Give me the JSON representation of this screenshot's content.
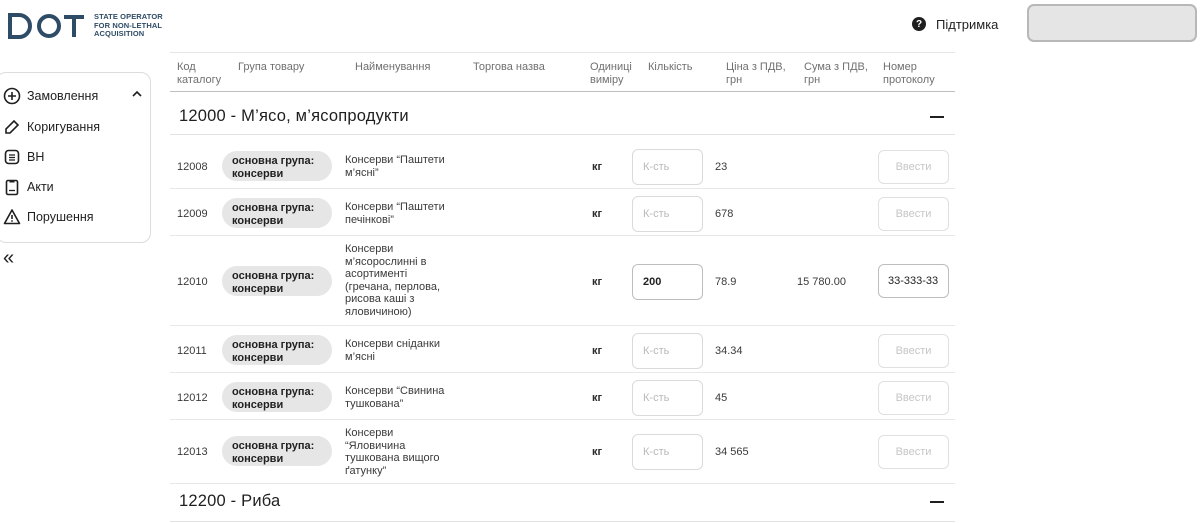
{
  "header": {
    "logo_text": "DOT",
    "logo_subtitle_1": "STATE OPERATOR",
    "logo_subtitle_2": "FOR NON-LETHAL",
    "logo_subtitle_3": "ACQUISITION",
    "support_label": "Підтримка",
    "support_icon": "question-circle-icon"
  },
  "sidebar": {
    "items": [
      {
        "label": "Замовлення",
        "icon": "plus-circle-icon"
      },
      {
        "label": "Коригування",
        "icon": "pencil-icon"
      },
      {
        "label": "ВН",
        "icon": "list-document-icon"
      },
      {
        "label": "Акти",
        "icon": "clipboard-icon"
      },
      {
        "label": "Порушення",
        "icon": "warning-triangle-icon"
      }
    ],
    "collapse_symbol": "«"
  },
  "table": {
    "columns": [
      {
        "line1": "Код",
        "line2": "каталогу"
      },
      {
        "line1": "Група товару",
        "line2": ""
      },
      {
        "line1": "Найменування",
        "line2": ""
      },
      {
        "line1": "Торгова назва",
        "line2": ""
      },
      {
        "line1": "Одиниці",
        "line2": "виміру"
      },
      {
        "line1": "Кількість",
        "line2": ""
      },
      {
        "line1": "Ціна з ПДВ,",
        "line2": "грн"
      },
      {
        "line1": "Сума з ПДВ,",
        "line2": "грн"
      },
      {
        "line1": "Номер",
        "line2": "протоколу"
      }
    ],
    "groups": [
      {
        "title": "12000 - М’ясо, м’ясопродукти"
      },
      {
        "title": "12200 - Риба"
      }
    ],
    "qty_placeholder": "К-сть",
    "protocol_placeholder": "Ввести",
    "rows": [
      {
        "code": "12008",
        "group_1": "основна група:",
        "group_2": "консерви",
        "name": [
          "Консерви “Паштети",
          "м’ясні”"
        ],
        "unit": "кг",
        "qty": "",
        "price": "23",
        "sum": "",
        "protocol": ""
      },
      {
        "code": "12009",
        "group_1": "основна група:",
        "group_2": "консерви",
        "name": [
          "Консерви “Паштети",
          "печінкові”"
        ],
        "unit": "кг",
        "qty": "",
        "price": "678",
        "sum": "",
        "protocol": ""
      },
      {
        "code": "12010",
        "group_1": "основна група:",
        "group_2": "консерви",
        "name": [
          "Консерви",
          "м’ясорослинні в",
          "асортименті",
          "(гречана, перлова,",
          "рисова каші з",
          "яловичиною)"
        ],
        "unit": "кг",
        "qty": "200",
        "price": "78.9",
        "sum": "15 780.00",
        "protocol": "33-333-33"
      },
      {
        "code": "12011",
        "group_1": "основна група:",
        "group_2": "консерви",
        "name": [
          "Консерви сніданки",
          "м’ясні"
        ],
        "unit": "кг",
        "qty": "",
        "price": "34.34",
        "sum": "",
        "protocol": ""
      },
      {
        "code": "12012",
        "group_1": "основна група:",
        "group_2": "консерви",
        "name": [
          "Консерви “Свинина",
          "тушкована”"
        ],
        "unit": "кг",
        "qty": "",
        "price": "45",
        "sum": "",
        "protocol": ""
      },
      {
        "code": "12013",
        "group_1": "основна група:",
        "group_2": "консерви",
        "name": [
          "Консерви",
          "“Яловичина",
          "тушкована вищого",
          "ґатунку”"
        ],
        "unit": "кг",
        "qty": "",
        "price": "34 565",
        "sum": "",
        "protocol": ""
      }
    ]
  }
}
